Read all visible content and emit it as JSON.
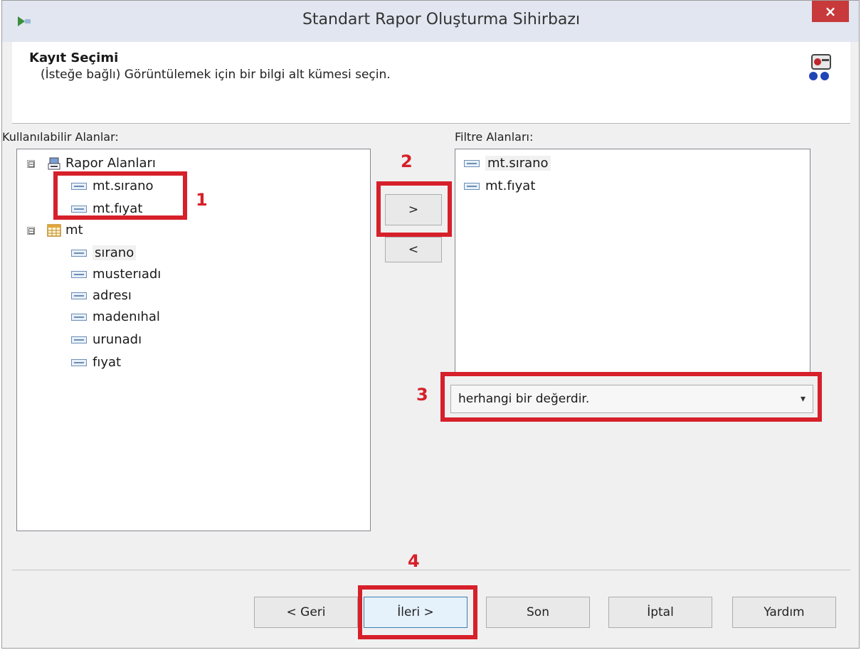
{
  "window": {
    "title": "Standart Rapor Oluşturma Sihirbazı",
    "close_label": "×"
  },
  "header": {
    "title": "Kayıt Seçimi",
    "subtitle": "(İsteğe bağlı) Görüntülemek için bir bilgi alt kümesi seçin."
  },
  "available": {
    "label": "Kullanılabilir Alanlar:",
    "groups": [
      {
        "name": "Rapor Alanları",
        "items": [
          "mt.sırano",
          "mt.fıyat"
        ]
      },
      {
        "name": "mt",
        "items": [
          "sırano",
          "musterıadı",
          "adresı",
          "madenıhal",
          "urunadı",
          "fıyat"
        ]
      }
    ]
  },
  "filter": {
    "label": "Filtre Alanları:",
    "items": [
      "mt.sırano",
      "mt.fıyat"
    ],
    "condition": "herhangi bir değerdir."
  },
  "transfer": {
    "add_label": ">",
    "remove_label": "<"
  },
  "buttons": {
    "back": "< Geri",
    "next": "İleri >",
    "finish": "Son",
    "cancel": "İptal",
    "help": "Yardım"
  },
  "annotations": [
    "1",
    "2",
    "3",
    "4"
  ],
  "expander": "⊟"
}
